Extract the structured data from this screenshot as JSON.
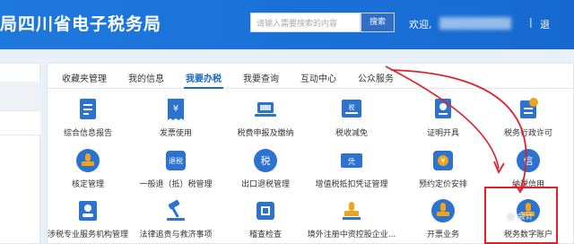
{
  "header": {
    "title": "局四川省电子税务局",
    "search_placeholder": "请输入需要搜索的内容",
    "search_button": "搜索",
    "welcome": "欢迎,",
    "divider": "|",
    "logout": "退"
  },
  "tabs": [
    "收藏夹管理",
    "我的信息",
    "我要办税",
    "我要查询",
    "互动中心",
    "公众服务"
  ],
  "active_tab": "我要办税",
  "tiles_row1": [
    "综合信息报告",
    "发票使用",
    "税费申报及缴纳",
    "税收减免",
    "证明开具",
    "税务行政许可"
  ],
  "tiles_row2": [
    "核定管理",
    "一般退（抵）税管理",
    "出口退税管理",
    "增值税抵扣凭证管理",
    "预约定价安排",
    "纳税信用"
  ],
  "tiles_row3": [
    "涉税专业服务机构管理",
    "法律追责与救济事项",
    "稽查检查",
    "境外注册中资控股企业...",
    "开票业务",
    "税务数字账户"
  ],
  "icon_text": {
    "tui": "退税",
    "shui": "税",
    "piao": "凭",
    "xin": "信",
    "yen": "¥"
  },
  "watermark": "@ 会计",
  "colors": {
    "header": "#1a6fd6",
    "accent": "#1a66c9",
    "icon": "#2b73cf",
    "icon_orange": "#f0a21b",
    "annotation": "#e0202b"
  }
}
